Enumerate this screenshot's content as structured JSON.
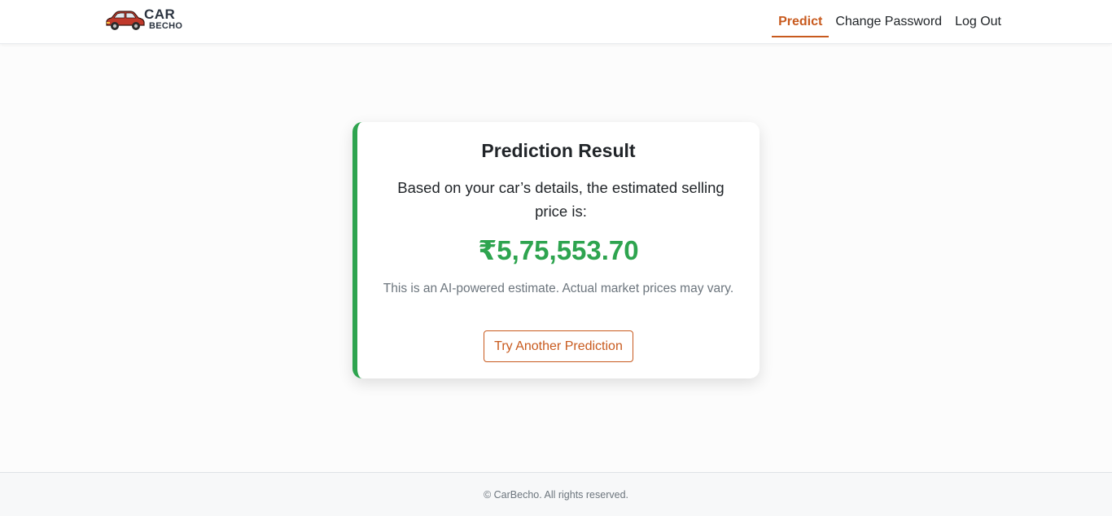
{
  "brand": {
    "word1": "CAR",
    "word2": "BECHO",
    "icon": "car-icon",
    "colors": {
      "car_body": "#c0392b",
      "text": "#2b3440"
    }
  },
  "nav": {
    "items": [
      {
        "label": "Predict",
        "active": true
      },
      {
        "label": "Change Password",
        "active": false
      },
      {
        "label": "Log Out",
        "active": false
      }
    ]
  },
  "result": {
    "title": "Prediction Result",
    "description": "Based on your car’s details, the estimated selling price is:",
    "price": "₹5,75,553.70",
    "note": "This is an AI-powered estimate. Actual market prices may vary.",
    "button_label": "Try Another Prediction"
  },
  "footer": {
    "text": "© CarBecho. All rights reserved."
  },
  "colors": {
    "accent": "#c85a1e",
    "success": "#2ea44f",
    "muted": "#6c757d"
  }
}
